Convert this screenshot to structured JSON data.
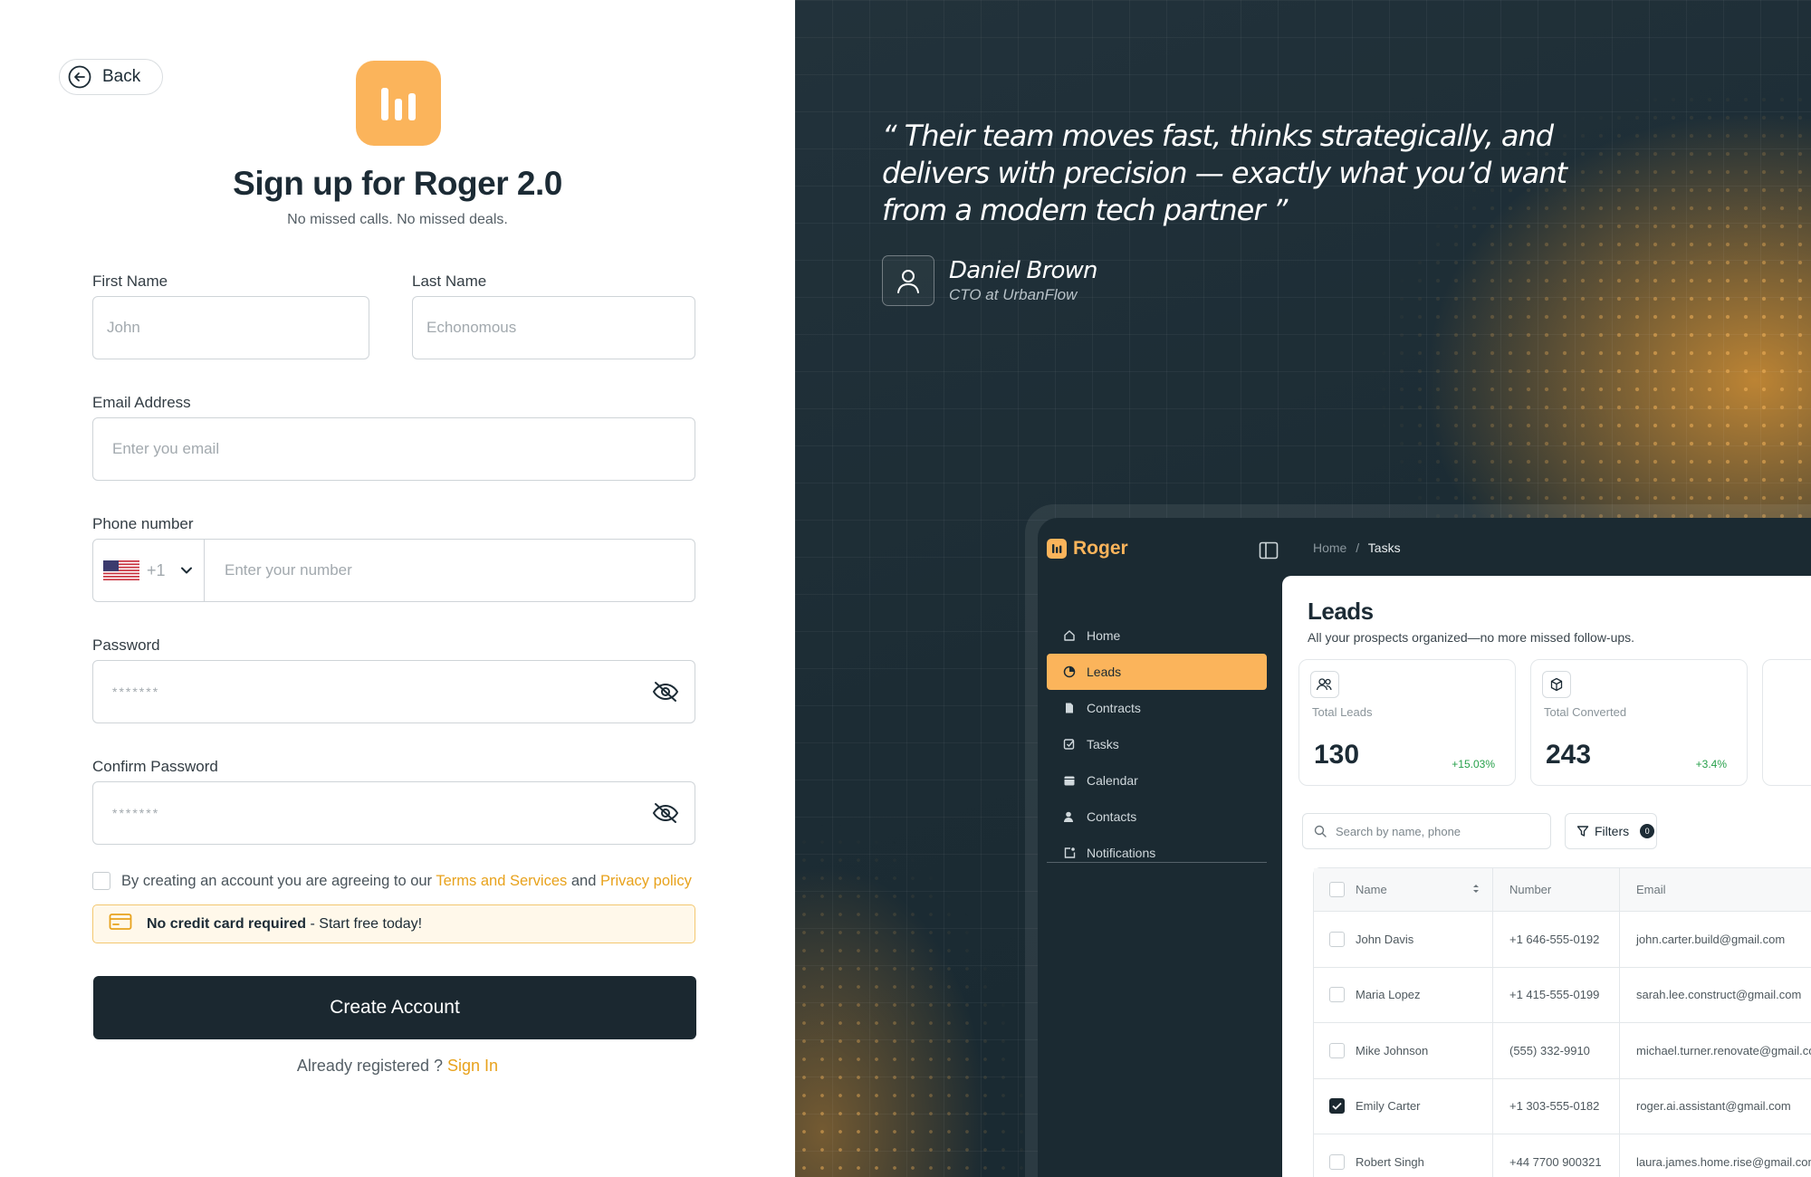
{
  "signup": {
    "back_label": "Back",
    "title": "Sign up for Roger 2.0",
    "subtitle": "No missed calls. No missed deals.",
    "first_name": {
      "label": "First Name",
      "placeholder": "John"
    },
    "last_name": {
      "label": "Last Name",
      "placeholder": "Echonomous"
    },
    "email": {
      "label": "Email Address",
      "placeholder": "Enter you email"
    },
    "phone": {
      "label": "Phone number",
      "country_code": "+1",
      "placeholder": "Enter your number"
    },
    "password": {
      "label": "Password",
      "value": "*******"
    },
    "confirm_password": {
      "label": "Confirm Password",
      "value": "*******"
    },
    "agree_prefix": "By creating an account you are agreeing to our",
    "terms_link": "Terms and Services",
    "agree_and": "and",
    "privacy_link": "Privacy policy",
    "notice_bold": "No credit card required",
    "notice_rest": "- Start free today!",
    "create_label": "Create Account",
    "signin_prefix": "Already registered ?",
    "signin_link": "Sign In"
  },
  "testimonial": {
    "quote": "“ Their team moves fast, thinks strategically, and delivers with precision — exactly what you’d want from a modern tech partner ”",
    "name": "Daniel Brown",
    "role": "CTO at UrbanFlow"
  },
  "app": {
    "brand": "Roger",
    "breadcrumb_home": "Home",
    "breadcrumb_sep": "/",
    "breadcrumb_current": "Tasks",
    "nav": [
      {
        "label": "Home",
        "icon": "home-icon"
      },
      {
        "label": "Leads",
        "icon": "pie-chart-icon"
      },
      {
        "label": "Contracts",
        "icon": "document-icon"
      },
      {
        "label": "Tasks",
        "icon": "checkbox-icon"
      },
      {
        "label": "Calendar",
        "icon": "calendar-icon"
      },
      {
        "label": "Contacts",
        "icon": "person-icon"
      },
      {
        "label": "Notifications",
        "icon": "notification-icon"
      }
    ],
    "page_title": "Leads",
    "page_subtitle": "All your prospects organized—no more missed follow-ups.",
    "stats": [
      {
        "label": "Total Leads",
        "value": "130",
        "delta": "+15.03%"
      },
      {
        "label": "Total Converted",
        "value": "243",
        "delta": "+3.4%"
      }
    ],
    "search_placeholder": "Search by name, phone",
    "filters_label": "Filters",
    "filters_count": "0",
    "columns": [
      "Name",
      "Number",
      "Email"
    ],
    "rows": [
      {
        "name": "John Davis",
        "number": "+1 646-555-0192",
        "email": "john.carter.build@gmail.com",
        "checked": false
      },
      {
        "name": "Maria Lopez",
        "number": "+1 415-555-0199",
        "email": "sarah.lee.construct@gmail.com",
        "checked": false
      },
      {
        "name": "Mike Johnson",
        "number": "(555) 332-9910",
        "email": "michael.turner.renovate@gmail.com",
        "checked": false
      },
      {
        "name": "Emily Carter",
        "number": "+1 303-555-0182",
        "email": "roger.ai.assistant@gmail.com",
        "checked": true
      },
      {
        "name": "Robert Singh",
        "number": "+44 7700 900321",
        "email": "laura.james.home.rise@gmail.com",
        "checked": false
      }
    ]
  },
  "colors": {
    "accent": "#fbb45b",
    "dark": "#1b2830",
    "link": "#e8a21c"
  }
}
